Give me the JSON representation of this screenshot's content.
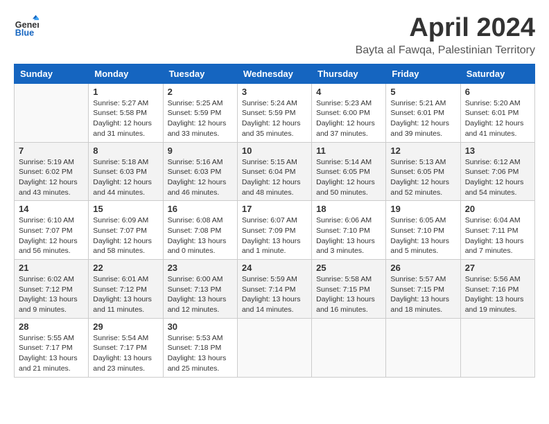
{
  "logo": {
    "text_general": "General",
    "text_blue": "Blue"
  },
  "header": {
    "title": "April 2024",
    "subtitle": "Bayta al Fawqa, Palestinian Territory"
  },
  "days_of_week": [
    "Sunday",
    "Monday",
    "Tuesday",
    "Wednesday",
    "Thursday",
    "Friday",
    "Saturday"
  ],
  "weeks": [
    [
      {
        "day": "",
        "info": ""
      },
      {
        "day": "1",
        "info": "Sunrise: 5:27 AM\nSunset: 5:58 PM\nDaylight: 12 hours\nand 31 minutes."
      },
      {
        "day": "2",
        "info": "Sunrise: 5:25 AM\nSunset: 5:59 PM\nDaylight: 12 hours\nand 33 minutes."
      },
      {
        "day": "3",
        "info": "Sunrise: 5:24 AM\nSunset: 5:59 PM\nDaylight: 12 hours\nand 35 minutes."
      },
      {
        "day": "4",
        "info": "Sunrise: 5:23 AM\nSunset: 6:00 PM\nDaylight: 12 hours\nand 37 minutes."
      },
      {
        "day": "5",
        "info": "Sunrise: 5:21 AM\nSunset: 6:01 PM\nDaylight: 12 hours\nand 39 minutes."
      },
      {
        "day": "6",
        "info": "Sunrise: 5:20 AM\nSunset: 6:01 PM\nDaylight: 12 hours\nand 41 minutes."
      }
    ],
    [
      {
        "day": "7",
        "info": "Sunrise: 5:19 AM\nSunset: 6:02 PM\nDaylight: 12 hours\nand 43 minutes."
      },
      {
        "day": "8",
        "info": "Sunrise: 5:18 AM\nSunset: 6:03 PM\nDaylight: 12 hours\nand 44 minutes."
      },
      {
        "day": "9",
        "info": "Sunrise: 5:16 AM\nSunset: 6:03 PM\nDaylight: 12 hours\nand 46 minutes."
      },
      {
        "day": "10",
        "info": "Sunrise: 5:15 AM\nSunset: 6:04 PM\nDaylight: 12 hours\nand 48 minutes."
      },
      {
        "day": "11",
        "info": "Sunrise: 5:14 AM\nSunset: 6:05 PM\nDaylight: 12 hours\nand 50 minutes."
      },
      {
        "day": "12",
        "info": "Sunrise: 5:13 AM\nSunset: 6:05 PM\nDaylight: 12 hours\nand 52 minutes."
      },
      {
        "day": "13",
        "info": "Sunrise: 6:12 AM\nSunset: 7:06 PM\nDaylight: 12 hours\nand 54 minutes."
      }
    ],
    [
      {
        "day": "14",
        "info": "Sunrise: 6:10 AM\nSunset: 7:07 PM\nDaylight: 12 hours\nand 56 minutes."
      },
      {
        "day": "15",
        "info": "Sunrise: 6:09 AM\nSunset: 7:07 PM\nDaylight: 12 hours\nand 58 minutes."
      },
      {
        "day": "16",
        "info": "Sunrise: 6:08 AM\nSunset: 7:08 PM\nDaylight: 13 hours\nand 0 minutes."
      },
      {
        "day": "17",
        "info": "Sunrise: 6:07 AM\nSunset: 7:09 PM\nDaylight: 13 hours\nand 1 minute."
      },
      {
        "day": "18",
        "info": "Sunrise: 6:06 AM\nSunset: 7:10 PM\nDaylight: 13 hours\nand 3 minutes."
      },
      {
        "day": "19",
        "info": "Sunrise: 6:05 AM\nSunset: 7:10 PM\nDaylight: 13 hours\nand 5 minutes."
      },
      {
        "day": "20",
        "info": "Sunrise: 6:04 AM\nSunset: 7:11 PM\nDaylight: 13 hours\nand 7 minutes."
      }
    ],
    [
      {
        "day": "21",
        "info": "Sunrise: 6:02 AM\nSunset: 7:12 PM\nDaylight: 13 hours\nand 9 minutes."
      },
      {
        "day": "22",
        "info": "Sunrise: 6:01 AM\nSunset: 7:12 PM\nDaylight: 13 hours\nand 11 minutes."
      },
      {
        "day": "23",
        "info": "Sunrise: 6:00 AM\nSunset: 7:13 PM\nDaylight: 13 hours\nand 12 minutes."
      },
      {
        "day": "24",
        "info": "Sunrise: 5:59 AM\nSunset: 7:14 PM\nDaylight: 13 hours\nand 14 minutes."
      },
      {
        "day": "25",
        "info": "Sunrise: 5:58 AM\nSunset: 7:15 PM\nDaylight: 13 hours\nand 16 minutes."
      },
      {
        "day": "26",
        "info": "Sunrise: 5:57 AM\nSunset: 7:15 PM\nDaylight: 13 hours\nand 18 minutes."
      },
      {
        "day": "27",
        "info": "Sunrise: 5:56 AM\nSunset: 7:16 PM\nDaylight: 13 hours\nand 19 minutes."
      }
    ],
    [
      {
        "day": "28",
        "info": "Sunrise: 5:55 AM\nSunset: 7:17 PM\nDaylight: 13 hours\nand 21 minutes."
      },
      {
        "day": "29",
        "info": "Sunrise: 5:54 AM\nSunset: 7:17 PM\nDaylight: 13 hours\nand 23 minutes."
      },
      {
        "day": "30",
        "info": "Sunrise: 5:53 AM\nSunset: 7:18 PM\nDaylight: 13 hours\nand 25 minutes."
      },
      {
        "day": "",
        "info": ""
      },
      {
        "day": "",
        "info": ""
      },
      {
        "day": "",
        "info": ""
      },
      {
        "day": "",
        "info": ""
      }
    ]
  ]
}
